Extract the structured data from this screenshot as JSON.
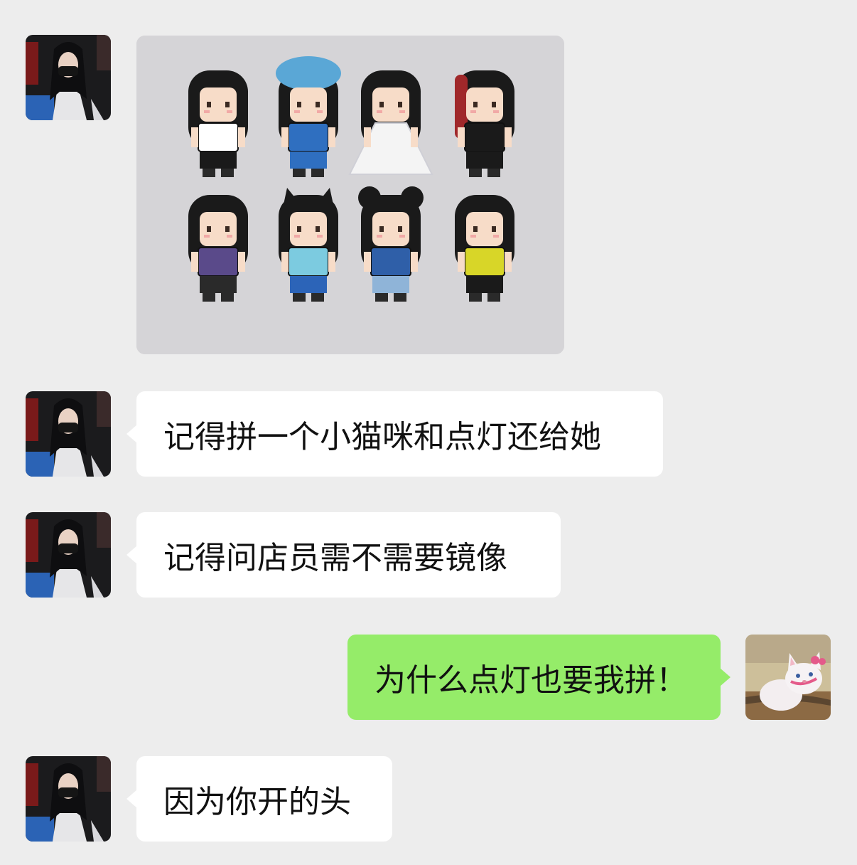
{
  "chat": {
    "messages": [
      {
        "sender": "contact",
        "type": "image",
        "image_desc": "pixel-bead-figures-photo"
      },
      {
        "sender": "contact",
        "type": "text",
        "text": "记得拼一个小猫咪和点灯还给她"
      },
      {
        "sender": "contact",
        "type": "text",
        "text": "记得问店员需不需要镜像"
      },
      {
        "sender": "self",
        "type": "text",
        "text": "为什么点灯也要我拼！"
      },
      {
        "sender": "contact",
        "type": "text",
        "text": "因为你开的头"
      }
    ]
  },
  "avatars": {
    "contact": {
      "icon": "masked-woman-avatar"
    },
    "self": {
      "icon": "white-cat-avatar"
    }
  },
  "colors": {
    "background": "#ededed",
    "incoming_bubble": "#ffffff",
    "outgoing_bubble": "#95ec69",
    "text": "#111111"
  }
}
